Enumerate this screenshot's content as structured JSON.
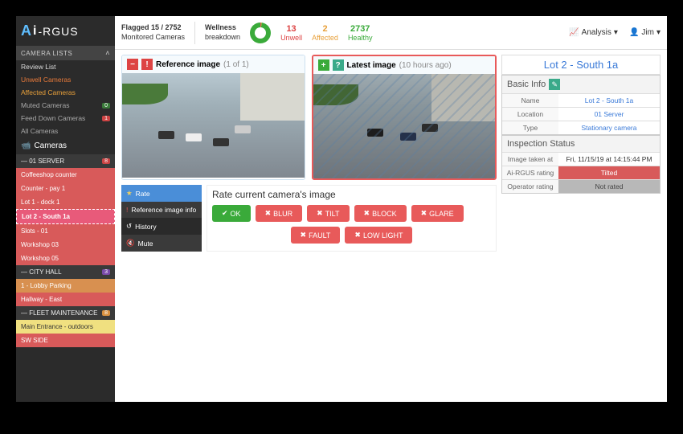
{
  "logo": {
    "a": "A",
    "i": "i",
    "rest": "-RGUS"
  },
  "sidebar": {
    "lists_header": "CAMERA LISTS",
    "review": "Review List",
    "unwell": "Unwell Cameras",
    "affected": "Affected Cameras",
    "muted": "Muted Cameras",
    "muted_badge": "0",
    "feed": "Feed Down Cameras",
    "feed_badge": "1",
    "all": "All Cameras",
    "cameras": "Cameras",
    "servers": [
      {
        "name": "— 01 SERVER",
        "badge": "8",
        "items": [
          {
            "label": "Coffeeshop counter",
            "cls": "cam-red"
          },
          {
            "label": "Counter - pay 1",
            "cls": "cam-red"
          },
          {
            "label": "Lot 1 - dock 1",
            "cls": "cam-red"
          },
          {
            "label": "Lot 2 - South 1a",
            "cls": "cam-selected"
          },
          {
            "label": "Slots - 01",
            "cls": "cam-red"
          },
          {
            "label": "Workshop 03",
            "cls": "cam-red"
          },
          {
            "label": "Workshop 05",
            "cls": "cam-red"
          }
        ]
      },
      {
        "name": "— CITY HALL",
        "badge": "3",
        "items": [
          {
            "label": "1 - Lobby Parking",
            "cls": "cam-orange"
          },
          {
            "label": "Hallway - East",
            "cls": "cam-red"
          }
        ]
      },
      {
        "name": "— FLEET MAINTENANCE",
        "badge": "8",
        "items": [
          {
            "label": "Main Entrance - outdoors",
            "cls": "cam-yellow"
          },
          {
            "label": "SW SIDE",
            "cls": "cam-red"
          }
        ]
      }
    ]
  },
  "topbar": {
    "flagged_line1": "Flagged 15 / 2752",
    "flagged_line2": "Monitored Cameras",
    "wellness_line1": "Wellness",
    "wellness_line2": "breakdown",
    "unwell_n": "13",
    "unwell_l": "Unwell",
    "affected_n": "2",
    "affected_l": "Affected",
    "healthy_n": "2737",
    "healthy_l": "Healthy",
    "analysis": "Analysis",
    "user": "Jim"
  },
  "images": {
    "ref_title": "Reference image",
    "ref_count": "(1 of 1)",
    "latest_title": "Latest image",
    "latest_time": "(10 hours ago)"
  },
  "tabs": {
    "rate": "Rate",
    "ref": "Reference image info",
    "history": "History",
    "mute": "Mute"
  },
  "rate": {
    "title": "Rate current camera's image",
    "ok": "OK",
    "blur": "BLUR",
    "tilt": "TILT",
    "block": "BLOCK",
    "glare": "GLARE",
    "fault": "FAULT",
    "lowlight": "LOW LIGHT"
  },
  "detail": {
    "title": "Lot 2 - South 1a",
    "basic_head": "Basic Info",
    "name_k": "Name",
    "name_v": "Lot 2 - South 1a",
    "loc_k": "Location",
    "loc_v": "01 Server",
    "type_k": "Type",
    "type_v": "Stationary camera",
    "status_head": "Inspection Status",
    "taken_k": "Image taken at",
    "taken_v": "Fri, 11/15/19 at 14:15:44 PM",
    "airgus_k": "Ai-RGUS rating",
    "airgus_v": "Tilted",
    "op_k": "Operator rating",
    "op_v": "Not rated"
  }
}
